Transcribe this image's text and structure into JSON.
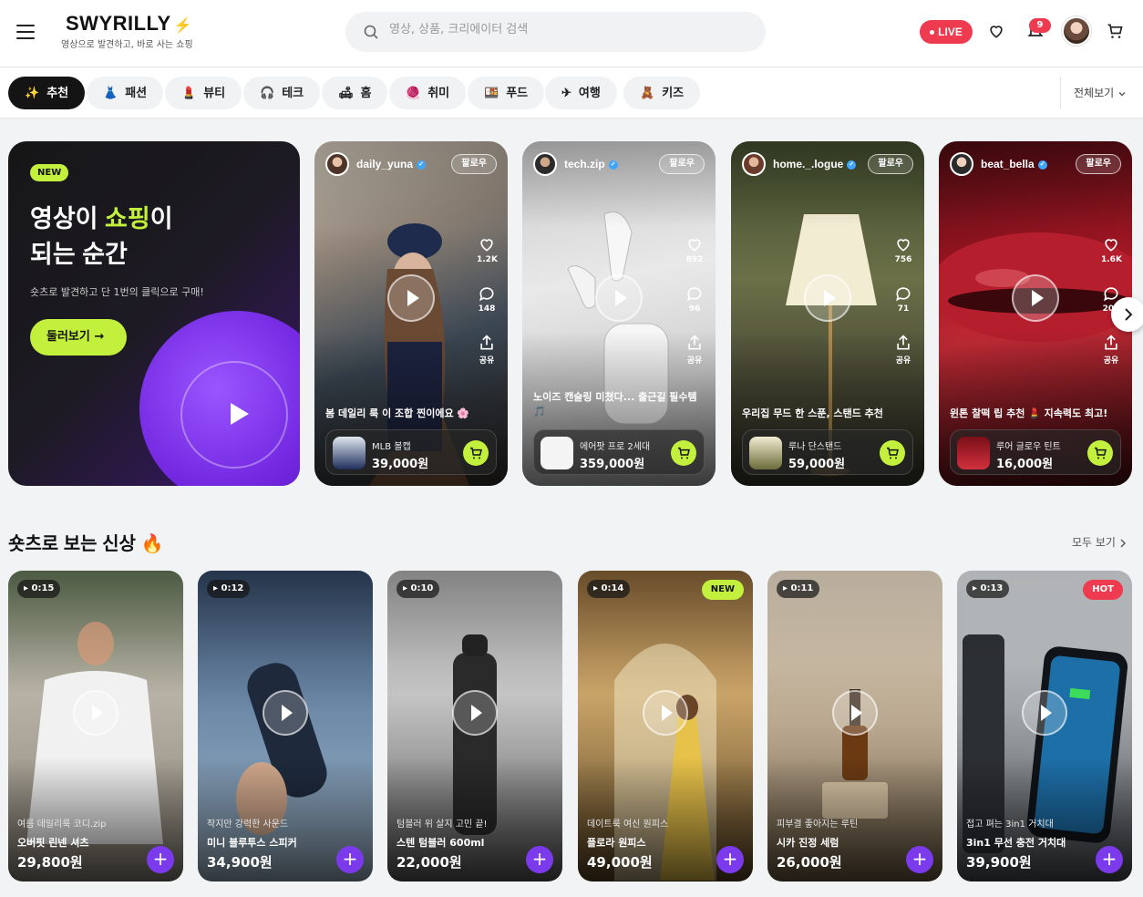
{
  "header": {
    "logo": "SWYRILLY",
    "logo_bolt": "⚡",
    "tagline": "영상으로 발견하고, 바로 사는 쇼핑",
    "search_placeholder": "영상, 상품, 크리에이터 검색",
    "live_label": "LIVE",
    "notification_count": "9"
  },
  "categories": [
    {
      "icon": "✨",
      "label": "추천",
      "active": true
    },
    {
      "icon": "👗",
      "label": "패션"
    },
    {
      "icon": "💄",
      "label": "뷰티"
    },
    {
      "icon": "🎧",
      "label": "테크"
    },
    {
      "icon": "🛋",
      "label": "홈"
    },
    {
      "icon": "🧶",
      "label": "취미"
    },
    {
      "icon": "🍱",
      "label": "푸드"
    },
    {
      "icon": "✈",
      "label": "여행"
    },
    {
      "icon": "🧸",
      "label": "키즈"
    }
  ],
  "category_view_all": "전체보기",
  "hero": {
    "badge": "NEW",
    "title_line1_a": "영상이 ",
    "title_line1_highlight": "쇼핑",
    "title_line1_b": "이",
    "title_line2": "되는 순간",
    "subtitle": "숏츠로 발견하고 단 1번의 클릭으로 구매!",
    "cta": "둘러보기 →"
  },
  "videos": [
    {
      "user": "daily_yuna",
      "follow": "팔로우",
      "likes": "1.2K",
      "comments": "148",
      "share": "공유",
      "caption": "봄 데일리 룩 이 조합 찐이에요 🌸",
      "product": "MLB 볼캡",
      "price": "39,000원"
    },
    {
      "user": "tech.zip",
      "follow": "팔로우",
      "likes": "892",
      "comments": "96",
      "share": "공유",
      "caption": "노이즈 캔슬링 미쳤다... 출근길 필수템 🎵",
      "product": "에어팟 프로 2세대",
      "price": "359,000원"
    },
    {
      "user": "home._.logue",
      "follow": "팔로우",
      "likes": "756",
      "comments": "71",
      "share": "공유",
      "caption": "우리집 무드 한 스푼, 스탠드 추천",
      "product": "루나 단스탠드",
      "price": "59,000원"
    },
    {
      "user": "beat_bella",
      "follow": "팔로우",
      "likes": "1.6K",
      "comments": "203",
      "share": "공유",
      "caption": "윈톤 찰떡 립 추천 💄 지속력도 최고!",
      "product": "루어 글로우 틴트",
      "price": "16,000원"
    }
  ],
  "shorts_section": {
    "title": "숏츠로 보는 신상 🔥",
    "view_all": "모두 보기",
    "items": [
      {
        "duration": "0:15",
        "badge": "",
        "subtitle": "여름 데일리룩 코디.zip",
        "name": "오버핏 린넨 셔츠",
        "price": "29,800원"
      },
      {
        "duration": "0:12",
        "badge": "",
        "subtitle": "작지만 강력한 사운드",
        "name": "미니 블루투스 스피커",
        "price": "34,900원"
      },
      {
        "duration": "0:10",
        "badge": "",
        "subtitle": "텀블러 위 살지 고민 끝!",
        "name": "스텐 텀블러 600ml",
        "price": "22,000원"
      },
      {
        "duration": "0:14",
        "badge": "NEW",
        "subtitle": "데이트룩 여신 원피스",
        "name": "플로라 원피스",
        "price": "49,000원"
      },
      {
        "duration": "0:11",
        "badge": "",
        "subtitle": "피부결 좋아지는 루틴",
        "name": "시카 진정 세럼",
        "price": "26,000원"
      },
      {
        "duration": "0:13",
        "badge": "HOT",
        "subtitle": "접고 펴는 3in1 거치대",
        "name": "3in1 무선 충전 거치대",
        "price": "39,900원"
      }
    ]
  },
  "colors": {
    "accent_lime": "#c3f03c",
    "live_red": "#ef3b4f",
    "purple": "#7c3aed"
  }
}
